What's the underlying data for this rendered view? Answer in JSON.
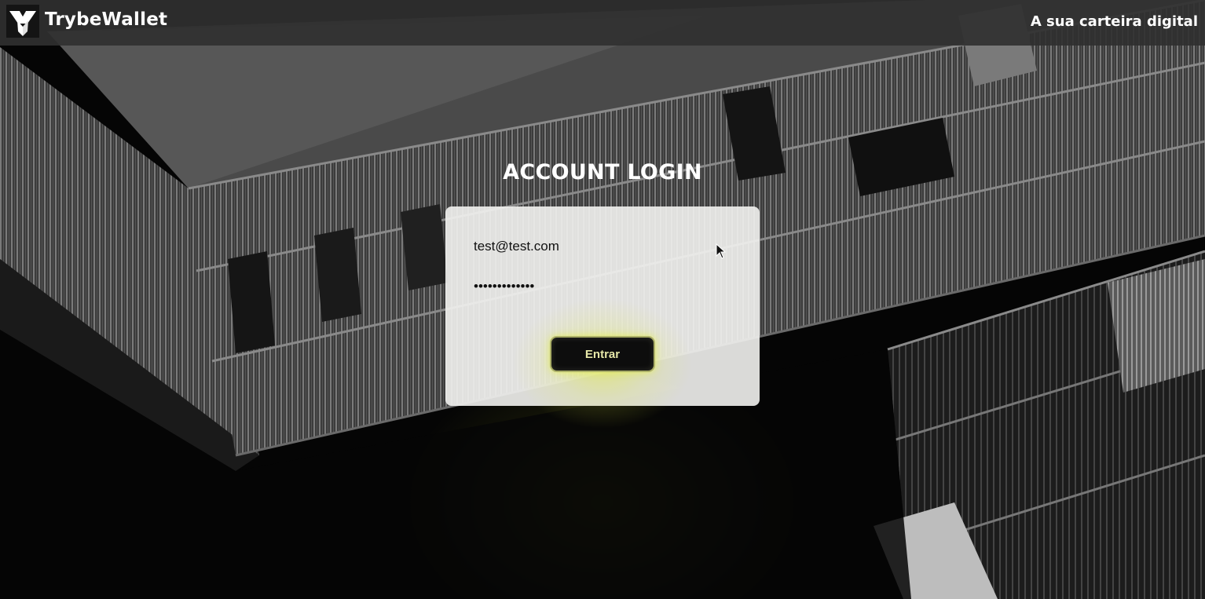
{
  "header": {
    "brand": "TrybeWallet",
    "tagline": "A sua carteira digital",
    "logo_icon": "trybe-logo-icon"
  },
  "login": {
    "title": "ACCOUNT LOGIN",
    "email_value": "test@test.com",
    "password_value": "•••••••••••••",
    "submit_label": "Entrar"
  },
  "colors": {
    "header_bg": "#303030",
    "card_bg": "#f2f2f0",
    "button_bg": "#0d0d0d",
    "button_text": "#e6e7a8",
    "glow": "#e1eb3c"
  }
}
